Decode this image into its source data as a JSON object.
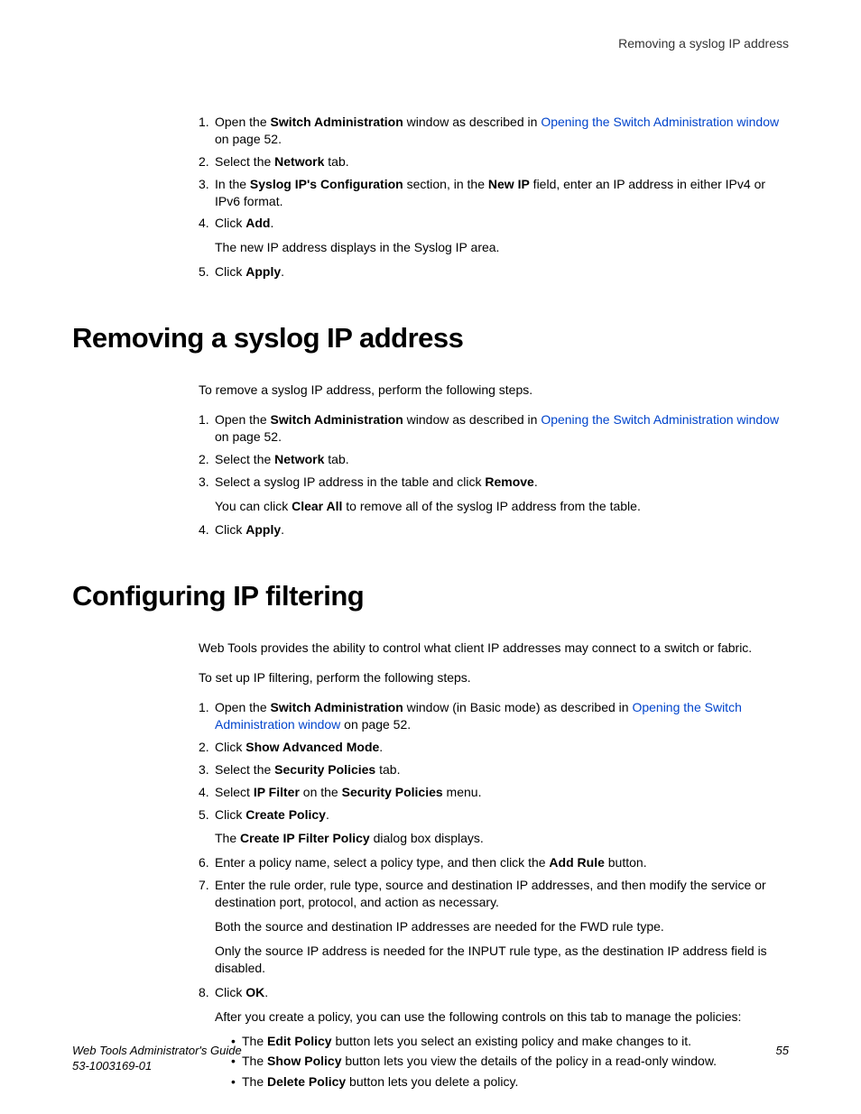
{
  "header": {
    "right": "Removing a syslog IP address"
  },
  "topSteps": {
    "items": [
      {
        "num": "1.",
        "pre": "Open the ",
        "bold1": "Switch Administration",
        "mid": " window as described in ",
        "link": "Opening the Switch Administration window",
        "post": " on page 52."
      },
      {
        "num": "2.",
        "pre": "Select the ",
        "bold1": "Network",
        "post": " tab."
      },
      {
        "num": "3.",
        "pre": "In the ",
        "bold1": "Syslog IP's Configuration",
        "mid": " section, in the ",
        "bold2": "New IP",
        "post": " field, enter an IP address in either IPv4 or IPv6 format."
      },
      {
        "num": "4.",
        "pre": "Click ",
        "bold1": "Add",
        "post": ".",
        "sub": "The new IP address displays in the Syslog IP area."
      },
      {
        "num": "5.",
        "pre": "Click ",
        "bold1": "Apply",
        "post": "."
      }
    ]
  },
  "section1": {
    "heading": "Removing a syslog IP address",
    "intro": "To remove a syslog IP address, perform the following steps.",
    "items": [
      {
        "num": "1.",
        "pre": "Open the ",
        "bold1": "Switch Administration",
        "mid": " window as described in ",
        "link": "Opening the Switch Administration window",
        "post": " on page 52."
      },
      {
        "num": "2.",
        "pre": "Select the ",
        "bold1": "Network",
        "post": " tab."
      },
      {
        "num": "3.",
        "pre": "Select a syslog IP address in the table and click ",
        "bold1": "Remove",
        "post": ".",
        "sub_pre": "You can click ",
        "sub_bold": "Clear All",
        "sub_post": " to remove all of the syslog IP address from the table."
      },
      {
        "num": "4.",
        "pre": "Click ",
        "bold1": "Apply",
        "post": "."
      }
    ]
  },
  "section2": {
    "heading": "Configuring IP filtering",
    "intro1": "Web Tools provides the ability to control what client IP addresses may connect to a switch or fabric.",
    "intro2": "To set up IP filtering, perform the following steps.",
    "items": [
      {
        "num": "1.",
        "pre": "Open the ",
        "bold1": "Switch Administration",
        "mid": " window (in Basic mode) as described in ",
        "link": "Opening the Switch Administration window",
        "post": " on page 52."
      },
      {
        "num": "2.",
        "pre": "Click ",
        "bold1": "Show Advanced Mode",
        "post": "."
      },
      {
        "num": "3.",
        "pre": "Select the ",
        "bold1": "Security Policies",
        "post": " tab."
      },
      {
        "num": "4.",
        "pre": "Select ",
        "bold1": "IP Filter",
        "mid": " on the ",
        "bold2": "Security Policies",
        "post": " menu."
      },
      {
        "num": "5.",
        "pre": "Click ",
        "bold1": "Create Policy",
        "post": ".",
        "sub_pre": "The ",
        "sub_bold": "Create IP Filter Policy",
        "sub_post": " dialog box displays."
      },
      {
        "num": "6.",
        "pre": "Enter a policy name, select a policy type, and then click the ",
        "bold1": "Add Rule",
        "post": " button."
      },
      {
        "num": "7.",
        "pre": "Enter the rule order, rule type, source and destination IP addresses, and then modify the service or destination port, protocol, and action as necessary.",
        "sub": "Both the source and destination IP addresses are needed for the FWD rule type.",
        "sub2": "Only the source IP address is needed for the INPUT rule type, as the destination IP address field is disabled."
      },
      {
        "num": "8.",
        "pre": "Click ",
        "bold1": "OK",
        "post": ".",
        "sub": "After you create a policy, you can use the following controls on this tab to manage the policies:"
      }
    ],
    "bullets": [
      {
        "pre": "The ",
        "bold": "Edit Policy",
        "post": " button lets you select an existing policy and make changes to it."
      },
      {
        "pre": "The ",
        "bold": "Show Policy",
        "post": " button lets you view the details of the policy in a read-only window."
      },
      {
        "pre": "The ",
        "bold": "Delete Policy",
        "post": " button lets you delete a policy."
      }
    ]
  },
  "footer": {
    "title": "Web Tools Administrator's Guide",
    "docnum": "53-1003169-01",
    "page": "55"
  }
}
